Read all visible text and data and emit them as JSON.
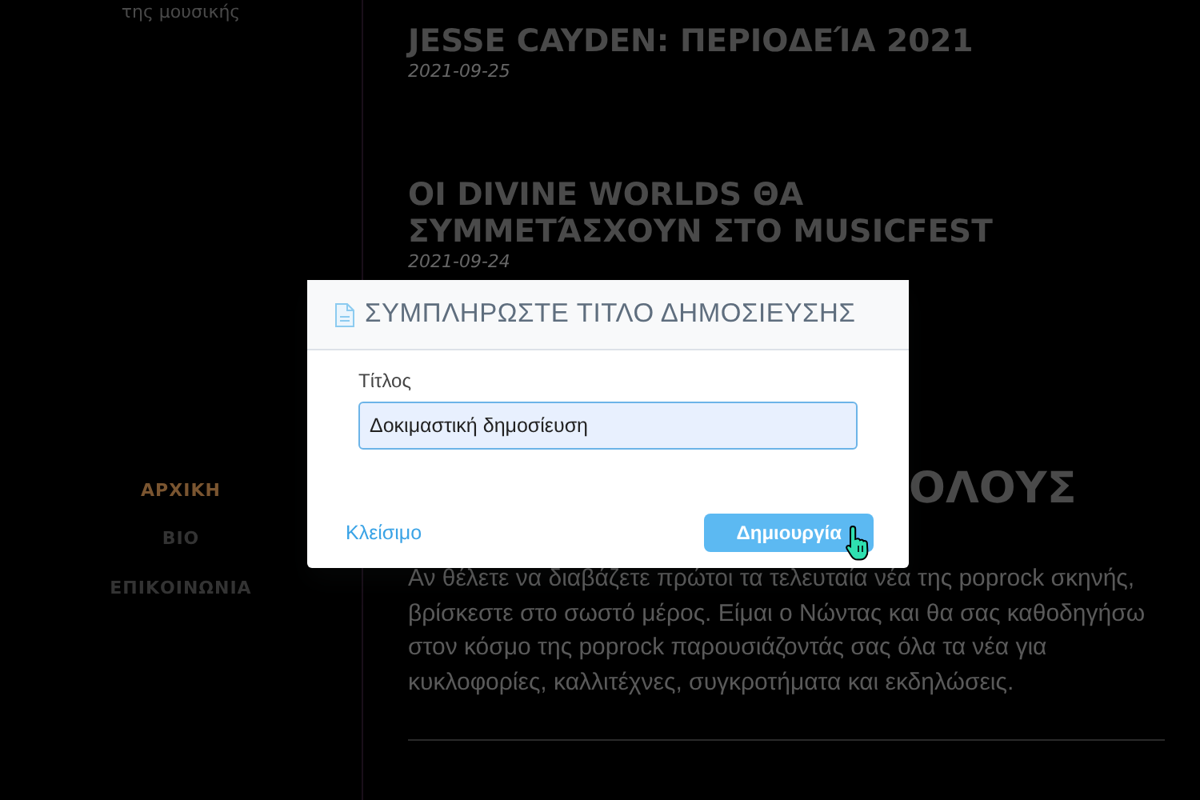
{
  "sidebar": {
    "tagline": "της μουσικής",
    "nav": [
      {
        "label": "ΑΡΧΙΚΗ",
        "selected": true
      },
      {
        "label": "ΒΙΟ",
        "selected": false
      },
      {
        "label": "ΕΠΙΚΟΙΝΩΝΙΑ",
        "selected": false
      }
    ]
  },
  "posts": [
    {
      "title": "JESSE CAYDEN: ΠΕΡΙΟΔΕΊΑ 2021",
      "date": "2021-09-25"
    },
    {
      "title": "ΟΙ DIVINE WORLDS ΘΑ ΣΥΜΜΕΤΆΣΧΟΥΝ ΣΤΟ MUSICFEST",
      "date": "2021-09-24"
    }
  ],
  "about": {
    "heading": "ΟΛΟΥΣ",
    "text": "Αν θέλετε να διαβάζετε πρώτοι τα τελευταία νέα της poprock σκηνής, βρίσκεστε στο σωστό μέρος. Είμαι ο Νώντας και θα σας καθοδηγήσω στον κόσμο της poprock παρουσιάζοντάς σας όλα τα νέα για κυκλοφορίες, καλλιτέχνες, συγκροτήματα και εκδηλώσεις."
  },
  "dialog": {
    "title": "ΣΥΜΠΛΗΡΩΣΤΕ ΤΙΤΛΟ ΔΗΜΟΣΙΕΥΣΗΣ",
    "field_label": "Τίτλος",
    "field_value": "Δοκιμαστική δημοσίευση",
    "close_link": "Κλείσιμο",
    "create_button": "Δημιουργία"
  }
}
